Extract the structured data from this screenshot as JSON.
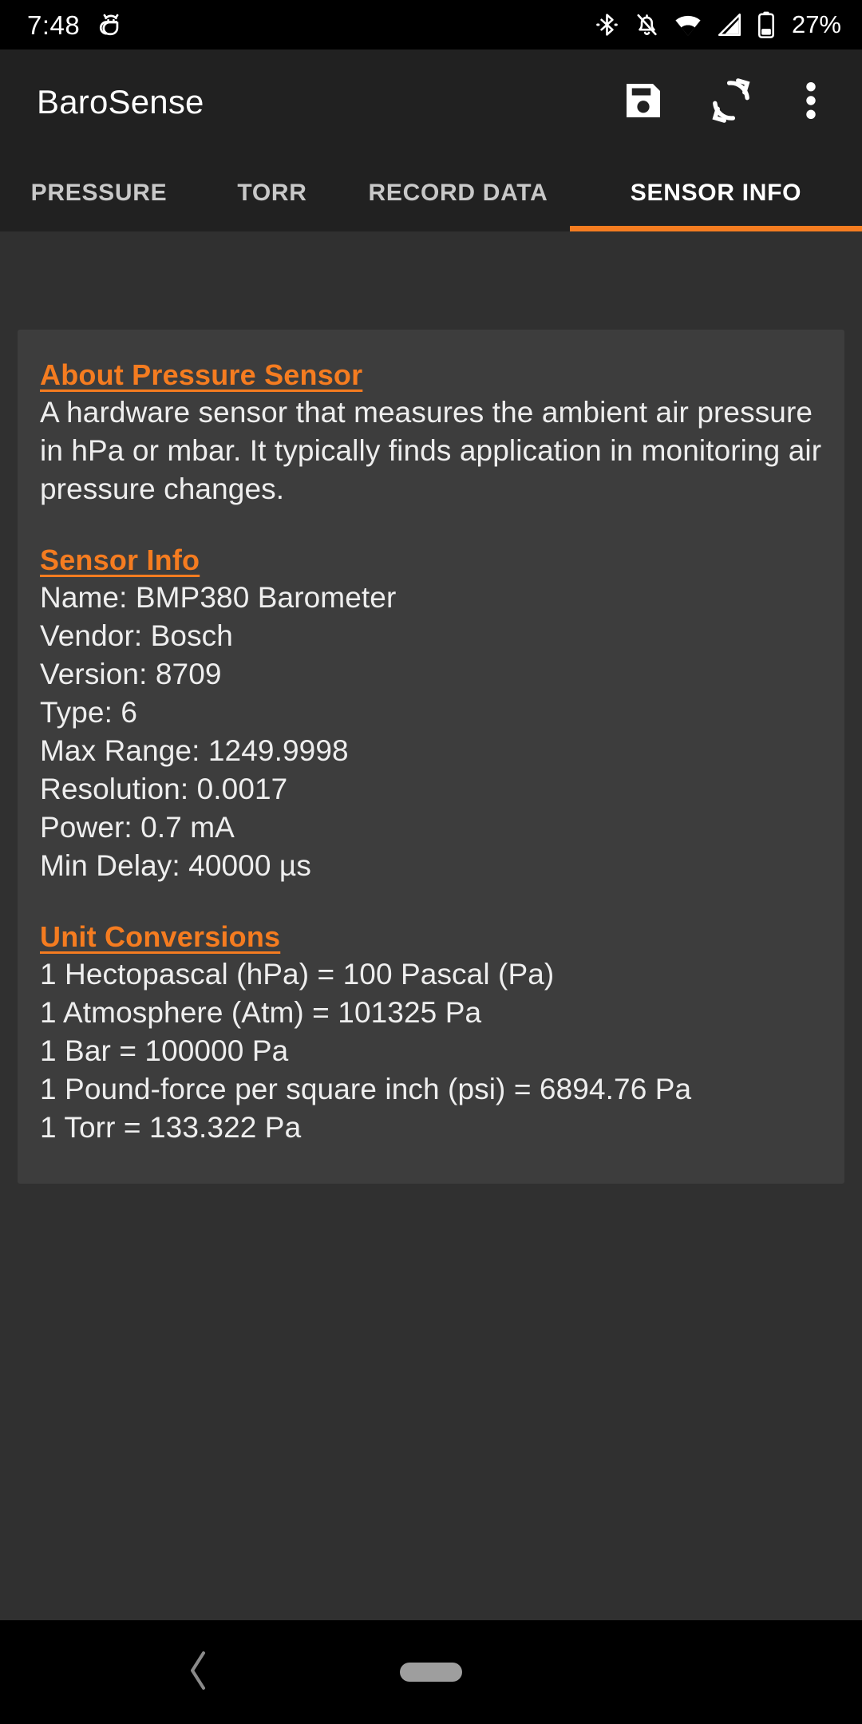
{
  "status_bar": {
    "time": "7:48",
    "battery_percent": "27%",
    "icons": {
      "notification": "android-debug-icon",
      "bluetooth": "bluetooth-icon",
      "ringer": "notifications-off-icon",
      "wifi": "wifi-icon",
      "cellular": "cellular-signal-icon",
      "battery": "battery-icon"
    }
  },
  "app_bar": {
    "title": "BaroSense",
    "actions": {
      "save": "save-icon",
      "refresh": "refresh-icon",
      "overflow": "more-vert-icon"
    }
  },
  "tabs": {
    "active_index": 3,
    "accent_color": "#f57c20",
    "items": [
      {
        "label": "PRESSURE"
      },
      {
        "label": "TORR"
      },
      {
        "label": "RECORD DATA"
      },
      {
        "label": "SENSOR INFO"
      }
    ]
  },
  "card": {
    "about": {
      "heading": "About Pressure Sensor",
      "body": "A hardware sensor that measures the ambient air pressure in hPa or mbar. It typically finds application in monitoring air pressure changes."
    },
    "sensor_info": {
      "heading": "Sensor Info",
      "lines": [
        "Name: BMP380 Barometer",
        "Vendor: Bosch",
        "Version: 8709",
        "Type: 6",
        "Max Range: 1249.9998",
        "Resolution: 0.0017",
        "Power: 0.7 mA",
        "Min Delay: 40000 µs"
      ]
    },
    "unit_conversions": {
      "heading": "Unit Conversions",
      "lines": [
        "1 Hectopascal (hPa) = 100 Pascal (Pa)",
        "1 Atmosphere (Atm) = 101325 Pa",
        "1 Bar = 100000 Pa",
        "1 Pound-force per square inch (psi) = 6894.76 Pa",
        "1 Torr = 133.322 Pa"
      ]
    }
  },
  "nav_bar": {
    "back": "back-chevron-icon",
    "home": "home-pill-icon"
  },
  "colors": {
    "accent": "#f57c20",
    "app_bar_bg": "#212121",
    "page_bg": "#303030",
    "card_bg": "#3d3d3d",
    "text_primary": "#eeeeee",
    "tab_inactive": "#c8c8c8"
  }
}
